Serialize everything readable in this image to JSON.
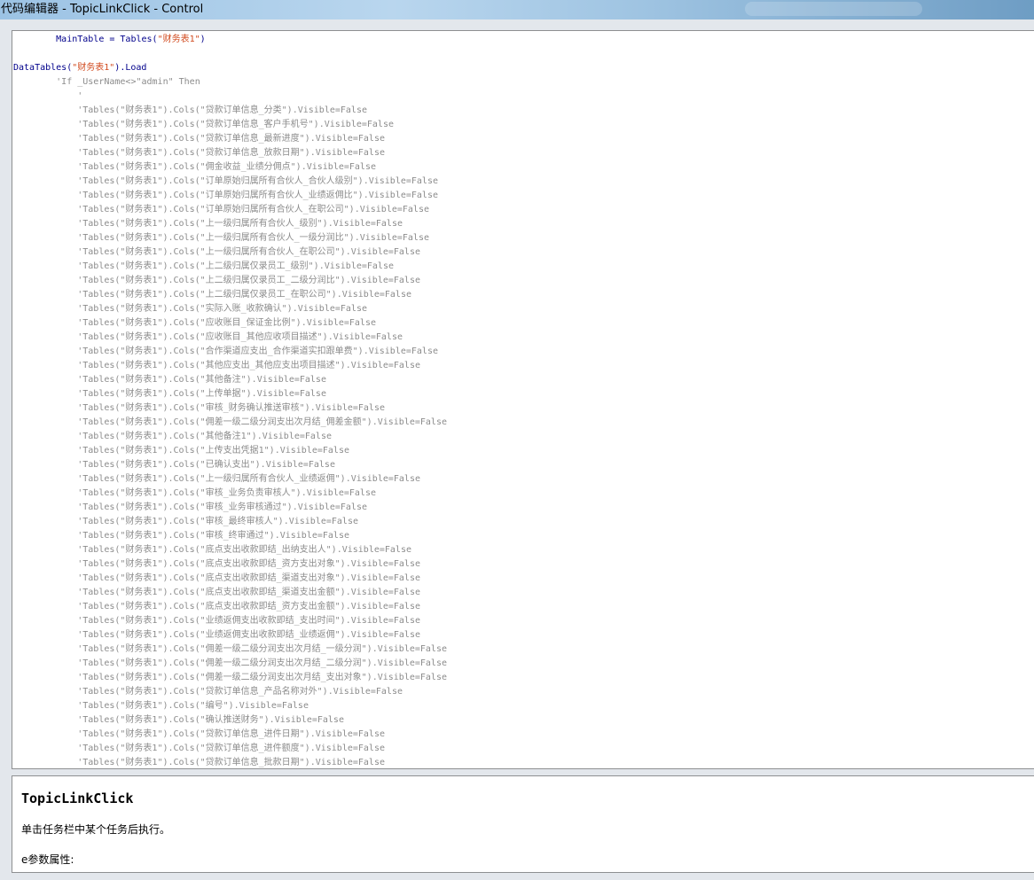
{
  "window": {
    "title": "代码编辑器 - TopicLinkClick - Control"
  },
  "colors": {
    "keyword": "#00008b",
    "string": "#d14a1e",
    "comment": "#8c8c8c"
  },
  "editor": {
    "lines": [
      [
        {
          "c": "kw",
          "t": "        MainTable = Tables("
        },
        {
          "c": "str",
          "t": "\"财务表1\""
        },
        {
          "c": "kw",
          "t": ")"
        }
      ],
      [],
      [
        {
          "c": "kw",
          "t": "DataTables("
        },
        {
          "c": "str",
          "t": "\"财务表1\""
        },
        {
          "c": "kw",
          "t": ").Load"
        }
      ],
      [
        {
          "c": "cmt",
          "t": "        'If _UserName<>\"admin\" Then"
        }
      ],
      [
        {
          "c": "cmt",
          "t": "            '"
        }
      ],
      [
        {
          "c": "cmt",
          "t": "            'Tables(\"财务表1\").Cols(\"贷款订单信息_分类\").Visible=False"
        }
      ],
      [
        {
          "c": "cmt",
          "t": "            'Tables(\"财务表1\").Cols(\"贷款订单信息_客户手机号\").Visible=False"
        }
      ],
      [
        {
          "c": "cmt",
          "t": "            'Tables(\"财务表1\").Cols(\"贷款订单信息_最新进度\").Visible=False"
        }
      ],
      [
        {
          "c": "cmt",
          "t": "            'Tables(\"财务表1\").Cols(\"贷款订单信息_放款日期\").Visible=False"
        }
      ],
      [
        {
          "c": "cmt",
          "t": "            'Tables(\"财务表1\").Cols(\"佣金收益_业绩分佣点\").Visible=False"
        }
      ],
      [
        {
          "c": "cmt",
          "t": "            'Tables(\"财务表1\").Cols(\"订单原始归属所有合伙人_合伙人级别\").Visible=False"
        }
      ],
      [
        {
          "c": "cmt",
          "t": "            'Tables(\"财务表1\").Cols(\"订单原始归属所有合伙人_业绩返佣比\").Visible=False"
        }
      ],
      [
        {
          "c": "cmt",
          "t": "            'Tables(\"财务表1\").Cols(\"订单原始归属所有合伙人_在职公司\").Visible=False"
        }
      ],
      [
        {
          "c": "cmt",
          "t": "            'Tables(\"财务表1\").Cols(\"上一级归属所有合伙人_级别\").Visible=False"
        }
      ],
      [
        {
          "c": "cmt",
          "t": "            'Tables(\"财务表1\").Cols(\"上一级归属所有合伙人_一级分润比\").Visible=False"
        }
      ],
      [
        {
          "c": "cmt",
          "t": "            'Tables(\"财务表1\").Cols(\"上一级归属所有合伙人_在职公司\").Visible=False"
        }
      ],
      [
        {
          "c": "cmt",
          "t": "            'Tables(\"财务表1\").Cols(\"上二级归属仅录员工_级别\").Visible=False"
        }
      ],
      [
        {
          "c": "cmt",
          "t": "            'Tables(\"财务表1\").Cols(\"上二级归属仅录员工_二级分润比\").Visible=False"
        }
      ],
      [
        {
          "c": "cmt",
          "t": "            'Tables(\"财务表1\").Cols(\"上二级归属仅录员工_在职公司\").Visible=False"
        }
      ],
      [
        {
          "c": "cmt",
          "t": "            'Tables(\"财务表1\").Cols(\"实际入账_收款确认\").Visible=False"
        }
      ],
      [
        {
          "c": "cmt",
          "t": "            'Tables(\"财务表1\").Cols(\"应收账目_保证金比例\").Visible=False"
        }
      ],
      [
        {
          "c": "cmt",
          "t": "            'Tables(\"财务表1\").Cols(\"应收账目_其他应收项目描述\").Visible=False"
        }
      ],
      [
        {
          "c": "cmt",
          "t": "            'Tables(\"财务表1\").Cols(\"合作渠道应支出_合作渠道实扣跟单费\").Visible=False"
        }
      ],
      [
        {
          "c": "cmt",
          "t": "            'Tables(\"财务表1\").Cols(\"其他应支出_其他应支出项目描述\").Visible=False"
        }
      ],
      [
        {
          "c": "cmt",
          "t": "            'Tables(\"财务表1\").Cols(\"其他备注\").Visible=False"
        }
      ],
      [
        {
          "c": "cmt",
          "t": "            'Tables(\"财务表1\").Cols(\"上传单据\").Visible=False"
        }
      ],
      [
        {
          "c": "cmt",
          "t": "            'Tables(\"财务表1\").Cols(\"审核_财务确认推送审核\").Visible=False"
        }
      ],
      [
        {
          "c": "cmt",
          "t": "            'Tables(\"财务表1\").Cols(\"佣差一级二级分润支出次月结_佣差金额\").Visible=False"
        }
      ],
      [
        {
          "c": "cmt",
          "t": "            'Tables(\"财务表1\").Cols(\"其他备注1\").Visible=False"
        }
      ],
      [
        {
          "c": "cmt",
          "t": "            'Tables(\"财务表1\").Cols(\"上传支出凭据1\").Visible=False"
        }
      ],
      [
        {
          "c": "cmt",
          "t": "            'Tables(\"财务表1\").Cols(\"已确认支出\").Visible=False"
        }
      ],
      [
        {
          "c": "cmt",
          "t": "            'Tables(\"财务表1\").Cols(\"上一级归属所有合伙人_业绩返佣\").Visible=False"
        }
      ],
      [
        {
          "c": "cmt",
          "t": "            'Tables(\"财务表1\").Cols(\"审核_业务负责审核人\").Visible=False"
        }
      ],
      [
        {
          "c": "cmt",
          "t": "            'Tables(\"财务表1\").Cols(\"审核_业务审核通过\").Visible=False"
        }
      ],
      [
        {
          "c": "cmt",
          "t": "            'Tables(\"财务表1\").Cols(\"审核_最终审核人\").Visible=False"
        }
      ],
      [
        {
          "c": "cmt",
          "t": "            'Tables(\"财务表1\").Cols(\"审核_终审通过\").Visible=False"
        }
      ],
      [
        {
          "c": "cmt",
          "t": "            'Tables(\"财务表1\").Cols(\"底点支出收款即结_出纳支出人\").Visible=False"
        }
      ],
      [
        {
          "c": "cmt",
          "t": "            'Tables(\"财务表1\").Cols(\"底点支出收款即结_资方支出对象\").Visible=False"
        }
      ],
      [
        {
          "c": "cmt",
          "t": "            'Tables(\"财务表1\").Cols(\"底点支出收款即结_渠道支出对象\").Visible=False"
        }
      ],
      [
        {
          "c": "cmt",
          "t": "            'Tables(\"财务表1\").Cols(\"底点支出收款即结_渠道支出金额\").Visible=False"
        }
      ],
      [
        {
          "c": "cmt",
          "t": "            'Tables(\"财务表1\").Cols(\"底点支出收款即结_资方支出金额\").Visible=False"
        }
      ],
      [
        {
          "c": "cmt",
          "t": "            'Tables(\"财务表1\").Cols(\"业绩返佣支出收款即结_支出时间\").Visible=False"
        }
      ],
      [
        {
          "c": "cmt",
          "t": "            'Tables(\"财务表1\").Cols(\"业绩返佣支出收款即结_业绩返佣\").Visible=False"
        }
      ],
      [
        {
          "c": "cmt",
          "t": "            'Tables(\"财务表1\").Cols(\"佣差一级二级分润支出次月结_一级分润\").Visible=False"
        }
      ],
      [
        {
          "c": "cmt",
          "t": "            'Tables(\"财务表1\").Cols(\"佣差一级二级分润支出次月结_二级分润\").Visible=False"
        }
      ],
      [
        {
          "c": "cmt",
          "t": "            'Tables(\"财务表1\").Cols(\"佣差一级二级分润支出次月结_支出对象\").Visible=False"
        }
      ],
      [
        {
          "c": "cmt",
          "t": "            'Tables(\"财务表1\").Cols(\"贷款订单信息_产品名称对外\").Visible=False"
        }
      ],
      [
        {
          "c": "cmt",
          "t": "            'Tables(\"财务表1\").Cols(\"编号\").Visible=False"
        }
      ],
      [
        {
          "c": "cmt",
          "t": "            'Tables(\"财务表1\").Cols(\"确认推送财务\").Visible=False"
        }
      ],
      [
        {
          "c": "cmt",
          "t": "            'Tables(\"财务表1\").Cols(\"贷款订单信息_进件日期\").Visible=False"
        }
      ],
      [
        {
          "c": "cmt",
          "t": "            'Tables(\"财务表1\").Cols(\"贷款订单信息_进件额度\").Visible=False"
        }
      ],
      [
        {
          "c": "cmt",
          "t": "            'Tables(\"财务表1\").Cols(\"贷款订单信息_批款日期\").Visible=False"
        }
      ]
    ]
  },
  "help": {
    "title": "TopicLinkClick",
    "description": "单击任务栏中某个任务后执行。",
    "param_heading": "e参数属性:"
  }
}
